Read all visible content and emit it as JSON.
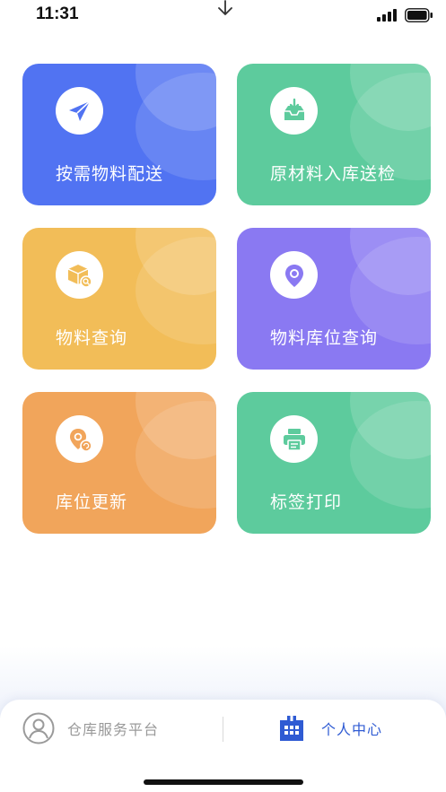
{
  "status_bar": {
    "time": "11:31"
  },
  "grid": {
    "cards": [
      {
        "label": "按需物料配送",
        "icon": "paper-plane-icon",
        "color": "#5173f2"
      },
      {
        "label": "原材料入库送检",
        "icon": "inbox-download-icon",
        "color": "#5dcb9d"
      },
      {
        "label": "物料查询",
        "icon": "package-search-icon",
        "color": "#f2bd58"
      },
      {
        "label": "物料库位查询",
        "icon": "map-pin-icon",
        "color": "#8a79f2"
      },
      {
        "label": "库位更新",
        "icon": "location-refresh-icon",
        "color": "#f1a55b"
      },
      {
        "label": "标签打印",
        "icon": "printer-icon",
        "color": "#5dcb9d"
      }
    ]
  },
  "tab_bar": {
    "left": {
      "label": "仓库服务平台",
      "icon": "user-avatar-icon"
    },
    "right": {
      "label": "个人中心",
      "icon": "apps-grid-icon",
      "active_color": "#2f5bd3"
    }
  }
}
